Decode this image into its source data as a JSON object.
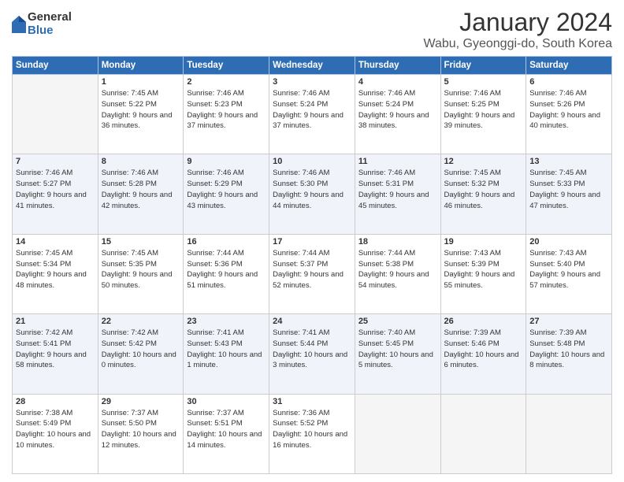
{
  "logo": {
    "general": "General",
    "blue": "Blue"
  },
  "title": "January 2024",
  "location": "Wabu, Gyeonggi-do, South Korea",
  "days_of_week": [
    "Sunday",
    "Monday",
    "Tuesday",
    "Wednesday",
    "Thursday",
    "Friday",
    "Saturday"
  ],
  "weeks": [
    [
      {
        "day": "",
        "empty": true
      },
      {
        "day": "1",
        "sunrise": "7:45 AM",
        "sunset": "5:22 PM",
        "daylight": "9 hours and 36 minutes."
      },
      {
        "day": "2",
        "sunrise": "7:46 AM",
        "sunset": "5:23 PM",
        "daylight": "9 hours and 37 minutes."
      },
      {
        "day": "3",
        "sunrise": "7:46 AM",
        "sunset": "5:24 PM",
        "daylight": "9 hours and 37 minutes."
      },
      {
        "day": "4",
        "sunrise": "7:46 AM",
        "sunset": "5:24 PM",
        "daylight": "9 hours and 38 minutes."
      },
      {
        "day": "5",
        "sunrise": "7:46 AM",
        "sunset": "5:25 PM",
        "daylight": "9 hours and 39 minutes."
      },
      {
        "day": "6",
        "sunrise": "7:46 AM",
        "sunset": "5:26 PM",
        "daylight": "9 hours and 40 minutes."
      }
    ],
    [
      {
        "day": "7",
        "sunrise": "7:46 AM",
        "sunset": "5:27 PM",
        "daylight": "9 hours and 41 minutes."
      },
      {
        "day": "8",
        "sunrise": "7:46 AM",
        "sunset": "5:28 PM",
        "daylight": "9 hours and 42 minutes."
      },
      {
        "day": "9",
        "sunrise": "7:46 AM",
        "sunset": "5:29 PM",
        "daylight": "9 hours and 43 minutes."
      },
      {
        "day": "10",
        "sunrise": "7:46 AM",
        "sunset": "5:30 PM",
        "daylight": "9 hours and 44 minutes."
      },
      {
        "day": "11",
        "sunrise": "7:46 AM",
        "sunset": "5:31 PM",
        "daylight": "9 hours and 45 minutes."
      },
      {
        "day": "12",
        "sunrise": "7:45 AM",
        "sunset": "5:32 PM",
        "daylight": "9 hours and 46 minutes."
      },
      {
        "day": "13",
        "sunrise": "7:45 AM",
        "sunset": "5:33 PM",
        "daylight": "9 hours and 47 minutes."
      }
    ],
    [
      {
        "day": "14",
        "sunrise": "7:45 AM",
        "sunset": "5:34 PM",
        "daylight": "9 hours and 48 minutes."
      },
      {
        "day": "15",
        "sunrise": "7:45 AM",
        "sunset": "5:35 PM",
        "daylight": "9 hours and 50 minutes."
      },
      {
        "day": "16",
        "sunrise": "7:44 AM",
        "sunset": "5:36 PM",
        "daylight": "9 hours and 51 minutes."
      },
      {
        "day": "17",
        "sunrise": "7:44 AM",
        "sunset": "5:37 PM",
        "daylight": "9 hours and 52 minutes."
      },
      {
        "day": "18",
        "sunrise": "7:44 AM",
        "sunset": "5:38 PM",
        "daylight": "9 hours and 54 minutes."
      },
      {
        "day": "19",
        "sunrise": "7:43 AM",
        "sunset": "5:39 PM",
        "daylight": "9 hours and 55 minutes."
      },
      {
        "day": "20",
        "sunrise": "7:43 AM",
        "sunset": "5:40 PM",
        "daylight": "9 hours and 57 minutes."
      }
    ],
    [
      {
        "day": "21",
        "sunrise": "7:42 AM",
        "sunset": "5:41 PM",
        "daylight": "9 hours and 58 minutes."
      },
      {
        "day": "22",
        "sunrise": "7:42 AM",
        "sunset": "5:42 PM",
        "daylight": "10 hours and 0 minutes."
      },
      {
        "day": "23",
        "sunrise": "7:41 AM",
        "sunset": "5:43 PM",
        "daylight": "10 hours and 1 minute."
      },
      {
        "day": "24",
        "sunrise": "7:41 AM",
        "sunset": "5:44 PM",
        "daylight": "10 hours and 3 minutes."
      },
      {
        "day": "25",
        "sunrise": "7:40 AM",
        "sunset": "5:45 PM",
        "daylight": "10 hours and 5 minutes."
      },
      {
        "day": "26",
        "sunrise": "7:39 AM",
        "sunset": "5:46 PM",
        "daylight": "10 hours and 6 minutes."
      },
      {
        "day": "27",
        "sunrise": "7:39 AM",
        "sunset": "5:48 PM",
        "daylight": "10 hours and 8 minutes."
      }
    ],
    [
      {
        "day": "28",
        "sunrise": "7:38 AM",
        "sunset": "5:49 PM",
        "daylight": "10 hours and 10 minutes."
      },
      {
        "day": "29",
        "sunrise": "7:37 AM",
        "sunset": "5:50 PM",
        "daylight": "10 hours and 12 minutes."
      },
      {
        "day": "30",
        "sunrise": "7:37 AM",
        "sunset": "5:51 PM",
        "daylight": "10 hours and 14 minutes."
      },
      {
        "day": "31",
        "sunrise": "7:36 AM",
        "sunset": "5:52 PM",
        "daylight": "10 hours and 16 minutes."
      },
      {
        "day": "",
        "empty": true
      },
      {
        "day": "",
        "empty": true
      },
      {
        "day": "",
        "empty": true
      }
    ]
  ]
}
